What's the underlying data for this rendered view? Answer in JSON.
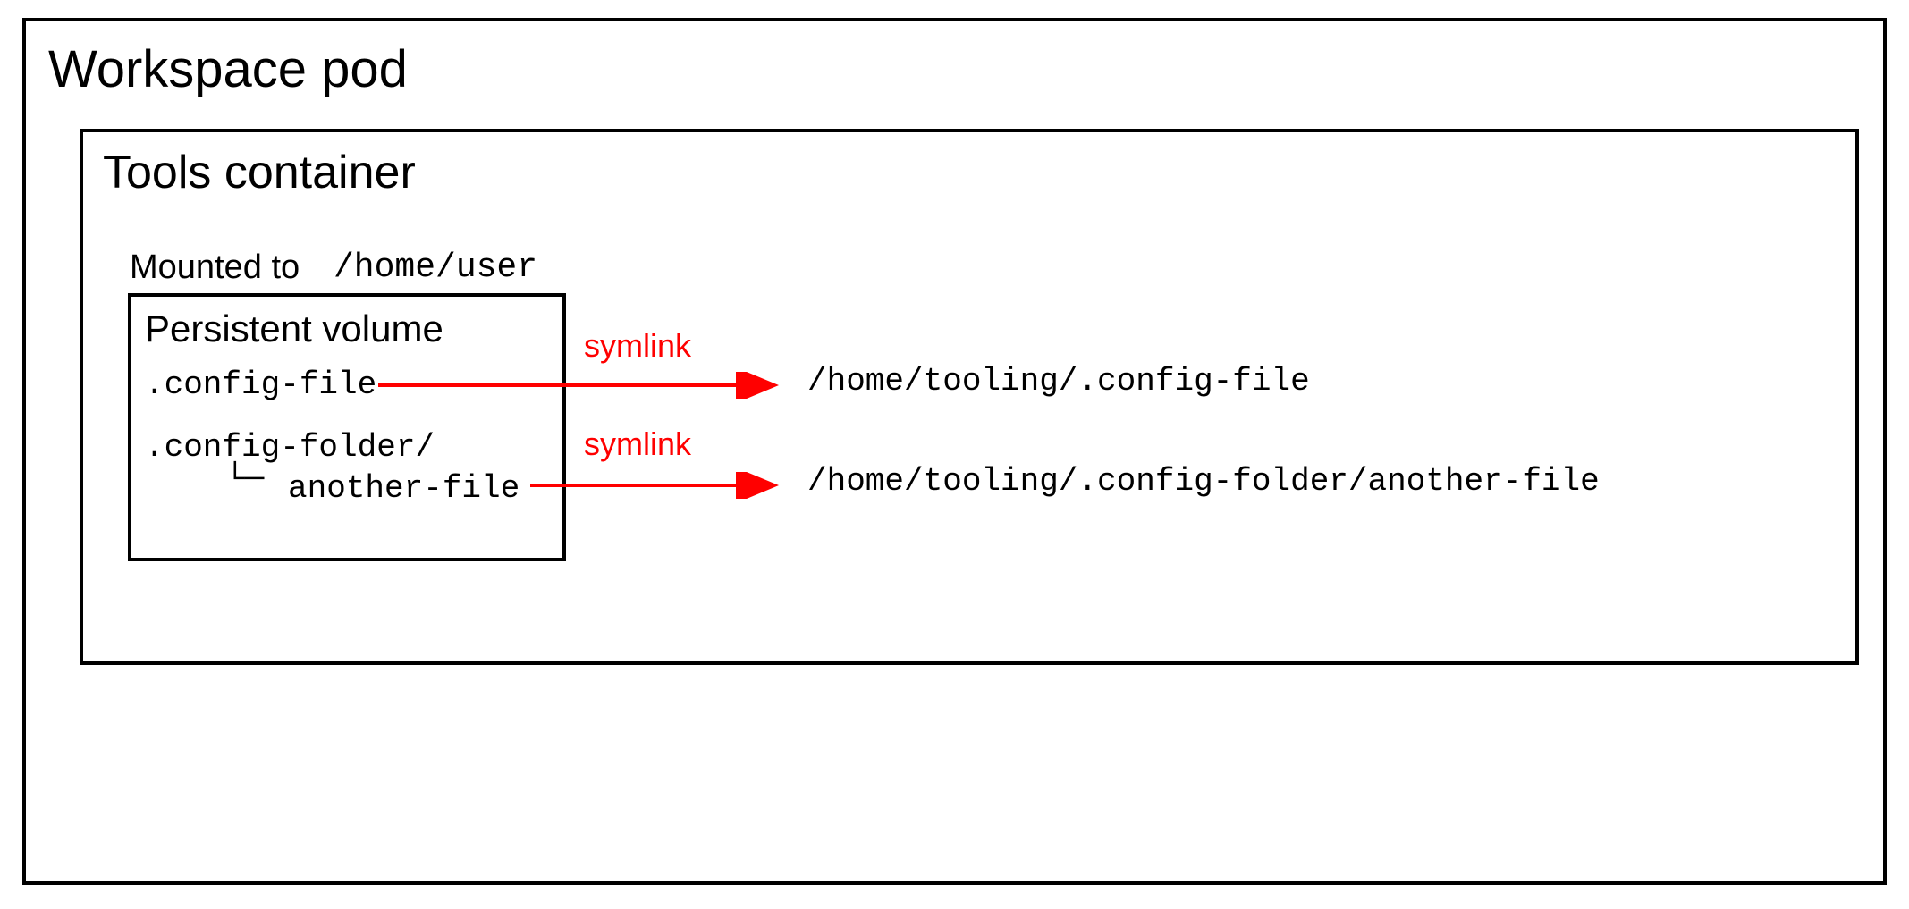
{
  "outer": {
    "title": "Workspace pod"
  },
  "inner": {
    "title": "Tools container"
  },
  "mounted": {
    "label": "Mounted to",
    "path": "/home/user"
  },
  "pv": {
    "title": "Persistent volume",
    "file1": ".config-file",
    "folder": ".config-folder/",
    "file2": "another-file"
  },
  "symlink": {
    "label": "symlink"
  },
  "targets": {
    "t1": "/home/tooling/.config-file",
    "t2": "/home/tooling/.config-folder/another-file"
  },
  "colors": {
    "symlink": "#ff0000",
    "border": "#000000"
  }
}
